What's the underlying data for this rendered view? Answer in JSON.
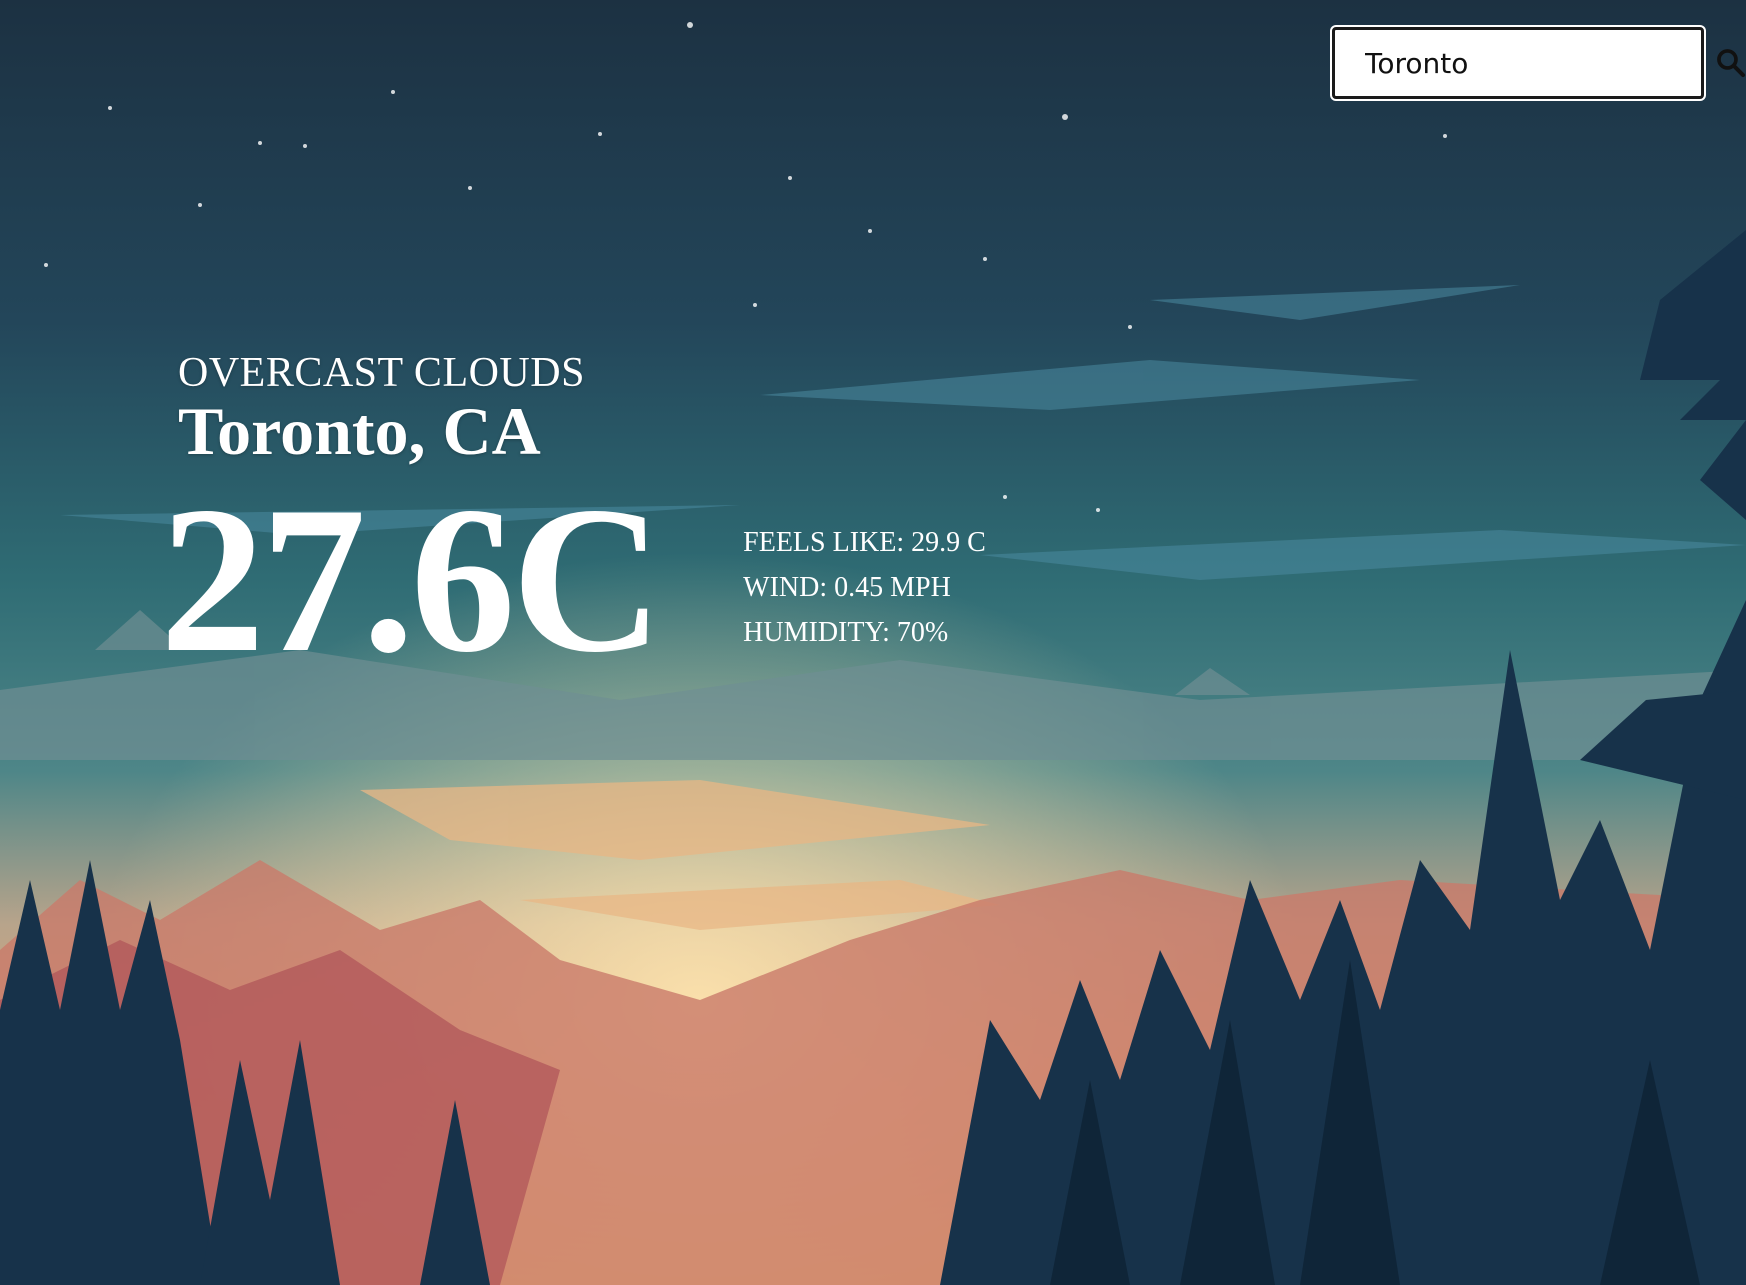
{
  "search": {
    "value": "Toronto",
    "icon": "search-icon"
  },
  "weather": {
    "condition": "OVERCAST CLOUDS",
    "location": "Toronto, CA",
    "temperature": "27.6C",
    "feels_like": "FEELS LIKE: 29.9 C",
    "wind": "WIND: 0.45 MPH",
    "humidity": "HUMIDITY: 70%"
  },
  "colors": {
    "sky_top": "#1e3445",
    "sky_mid": "#2f6a72",
    "horizon": "#e9b57a",
    "forest_dark": "#18324a"
  }
}
